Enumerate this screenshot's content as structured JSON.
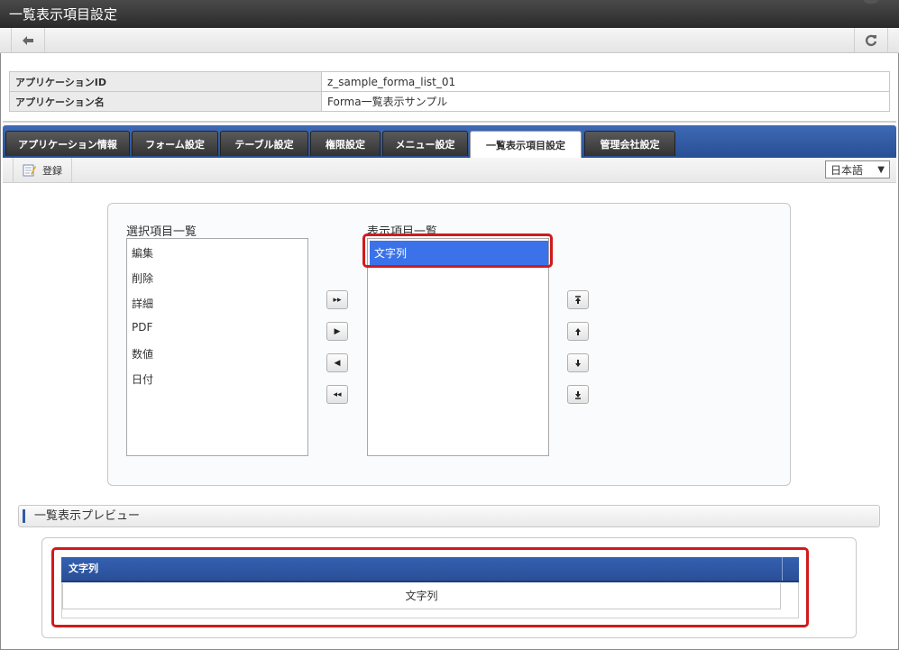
{
  "window": {
    "title": "一覧表示項目設定"
  },
  "toolbar": {
    "back_icon": "arrow-left-icon",
    "refresh_icon": "refresh-icon"
  },
  "app_info": {
    "rows": [
      {
        "label": "アプリケーションID",
        "value": "z_sample_forma_list_01"
      },
      {
        "label": "アプリケーション名",
        "value": "Forma一覧表示サンプル"
      }
    ]
  },
  "tabs": [
    {
      "label": "アプリケーション情報"
    },
    {
      "label": "フォーム設定"
    },
    {
      "label": "テーブル設定"
    },
    {
      "label": "権限設定"
    },
    {
      "label": "メニュー設定"
    },
    {
      "label": "一覧表示項目設定",
      "active": true
    },
    {
      "label": "管理会社設定"
    }
  ],
  "commands": {
    "register_label": "登録",
    "language": "日本語"
  },
  "selection": {
    "available_label": "選択項目一覧",
    "available_items": [
      "編集",
      "削除",
      "詳細",
      "PDF",
      "数値",
      "日付"
    ],
    "display_label": "表示項目一覧",
    "display_items": [
      "文字列"
    ]
  },
  "preview": {
    "section_title": "一覧表示プレビュー",
    "column_header": "文字列",
    "cell_value": "文字列"
  },
  "colors": {
    "accent": "#2f5aa8",
    "selected": "#3b72ea",
    "highlight": "#d21a1a"
  }
}
